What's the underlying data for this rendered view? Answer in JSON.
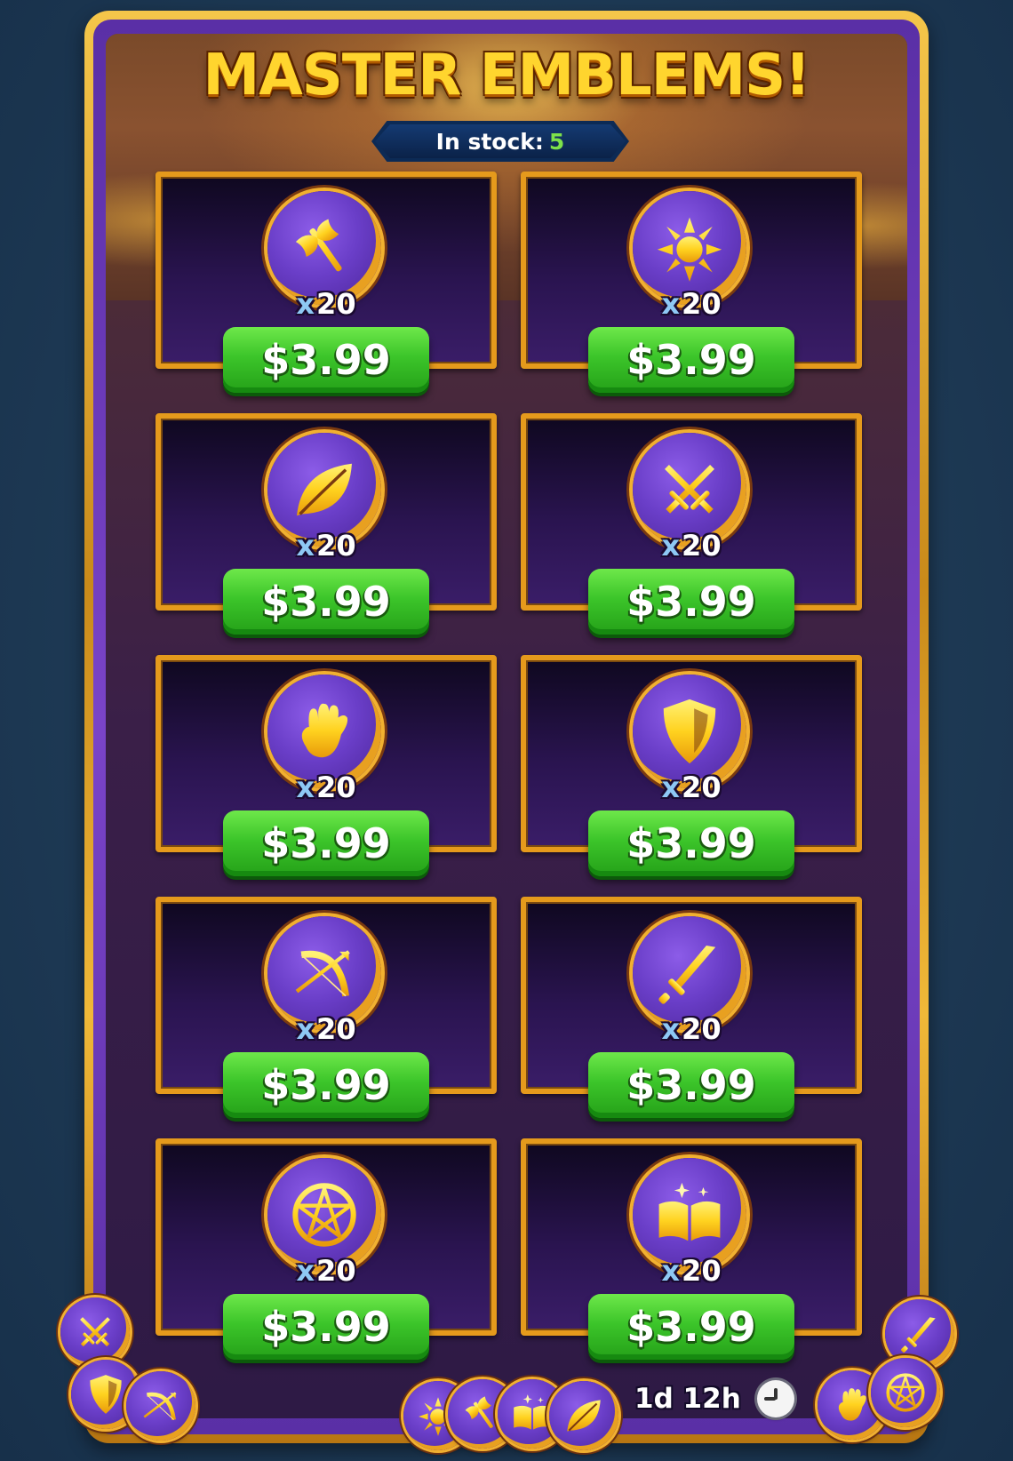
{
  "title": "MASTER EMBLEMS!",
  "stock": {
    "label": "In stock:",
    "value": "5"
  },
  "colors": {
    "accent_gold": "#e59a1c",
    "button_green": "#3cc52a",
    "stock_green": "#7de24a",
    "emblem_purple": "#6a3ec8"
  },
  "offers": [
    {
      "icon": "axe-icon",
      "qty_prefix": "x",
      "qty": "20",
      "price": "$3.99"
    },
    {
      "icon": "sun-icon",
      "qty_prefix": "x",
      "qty": "20",
      "price": "$3.99"
    },
    {
      "icon": "leaf-icon",
      "qty_prefix": "x",
      "qty": "20",
      "price": "$3.99"
    },
    {
      "icon": "crossed-swords-icon",
      "qty_prefix": "x",
      "qty": "20",
      "price": "$3.99"
    },
    {
      "icon": "hand-icon",
      "qty_prefix": "x",
      "qty": "20",
      "price": "$3.99"
    },
    {
      "icon": "shield-icon",
      "qty_prefix": "x",
      "qty": "20",
      "price": "$3.99"
    },
    {
      "icon": "bow-icon",
      "qty_prefix": "x",
      "qty": "20",
      "price": "$3.99"
    },
    {
      "icon": "dagger-icon",
      "qty_prefix": "x",
      "qty": "20",
      "price": "$3.99"
    },
    {
      "icon": "pentagram-icon",
      "qty_prefix": "x",
      "qty": "20",
      "price": "$3.99"
    },
    {
      "icon": "spellbook-icon",
      "qty_prefix": "x",
      "qty": "20",
      "price": "$3.99"
    }
  ],
  "timer": {
    "text": "1d 12h",
    "icon": "clock-icon"
  },
  "decorative_coins": [
    "crossed-swords-icon",
    "shield-icon",
    "bow-icon",
    "sun-icon",
    "axe-icon",
    "spellbook-icon",
    "leaf-icon",
    "dagger-icon",
    "hand-icon",
    "pentagram-icon"
  ]
}
